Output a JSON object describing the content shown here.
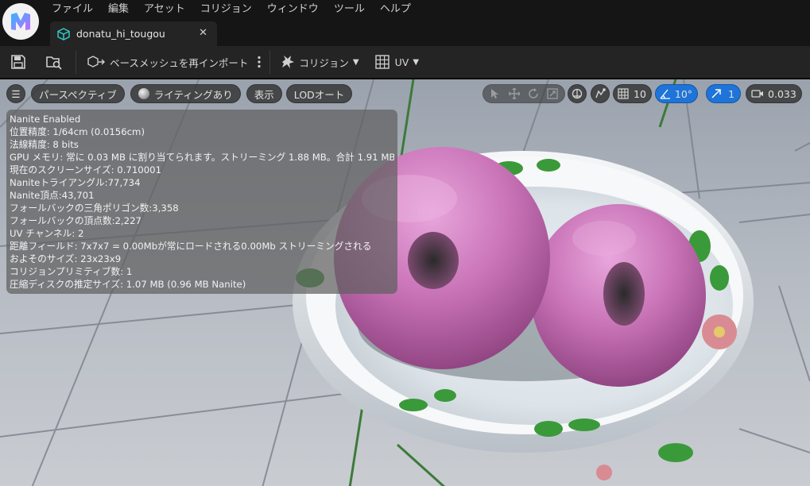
{
  "menu": [
    "ファイル",
    "編集",
    "アセット",
    "コリジョン",
    "ウィンドウ",
    "ツール",
    "ヘルプ"
  ],
  "tab": {
    "title": "donatu_hi_tougou"
  },
  "toolbar": {
    "reimport_label": "ベースメッシュを再インポート",
    "collision_label": "コリジョン",
    "uv_label": "UV"
  },
  "viewport": {
    "perspective": "パースペクティブ",
    "lighting": "ライティングあり",
    "show": "表示",
    "lod": "LODオート",
    "grid_snap": "10",
    "rotation_snap": "10°",
    "scale_snap": "1",
    "camera_speed": "0.033"
  },
  "stats": [
    "Nanite Enabled",
    "位置精度: 1/64cm (0.0156cm)",
    "法線精度: 8 bits",
    "GPU メモリ: 常に 0.03 MB に割り当てられます。ストリーミング 1.88 MB。合計 1.91 MB。",
    "現在のスクリーンサイズ: 0.710001",
    "Naniteトライアングル:77,734",
    "Nanite頂点:43,701",
    "フォールバックの三角ポリゴン数:3,358",
    "フォールバックの頂点数:2,227",
    "UV チャンネル: 2",
    "距離フィールド: 7x7x7 = 0.00Mbが常にロードされる0.00Mb ストリーミングされる",
    "およそのサイズ: 23x23x9",
    "コリジョンプリミティブ数: 1",
    "圧縮ディスクの推定サイズ: 1.07 MB (0.96 MB Nanite)"
  ],
  "icons": {
    "logo": "unreal-logo-icon",
    "mesh": "static-mesh-icon",
    "save": "save-icon",
    "browse": "browse-content-icon",
    "more": "more-vertical-icon",
    "collision": "collision-icon",
    "uv": "uv-grid-icon"
  },
  "colors": {
    "accent": "#1e74d8",
    "background": "#151515",
    "panel": "#242424",
    "donut": "#c86fb4"
  }
}
